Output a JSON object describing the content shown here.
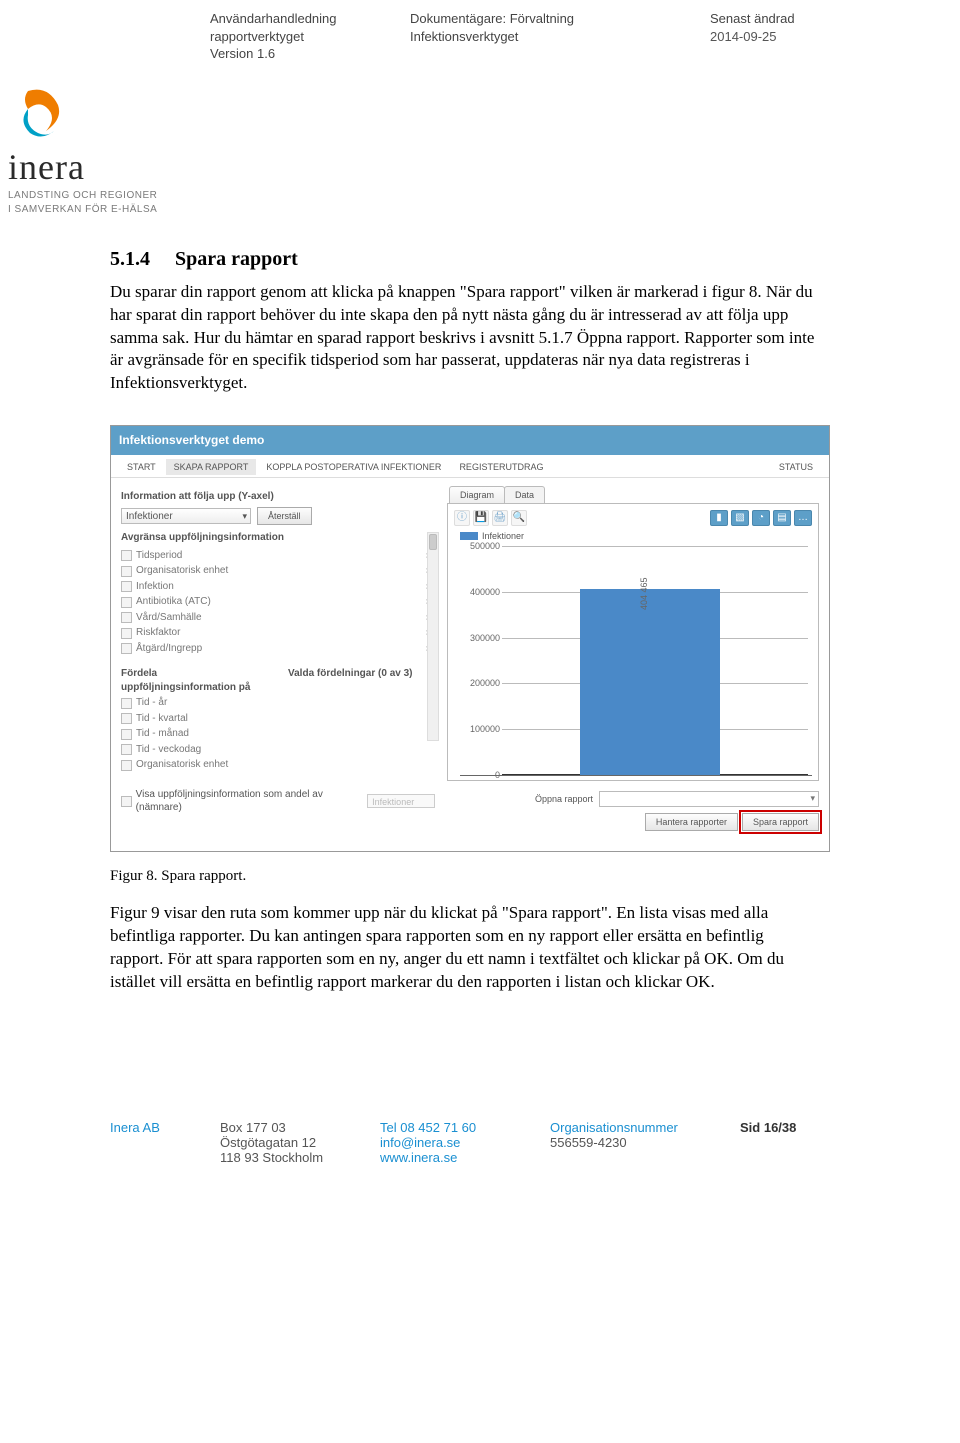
{
  "header": {
    "doc_title": "Användarhandledning rapportverktyget",
    "version": "Version 1.6",
    "owner_label": "Dokumentägare: Förvaltning",
    "owner_name": "Infektionsverktyget",
    "changed_label": "Senast ändrad",
    "changed_date": "2014-09-25",
    "logo_name": "inera",
    "logo_tag1": "LANDSTING OCH REGIONER",
    "logo_tag2": "I SAMVERKAN FÖR E-HÄLSA"
  },
  "section": {
    "num": "5.1.4",
    "title": "Spara rapport",
    "para": "Du sparar din rapport genom att klicka på knappen \"Spara rapport\" vilken är markerad i figur 8. När du har sparat din rapport behöver du inte skapa den på nytt nästa gång du är intresserad av att följa upp samma sak. Hur du hämtar en sparad rapport beskrivs i avsnitt 5.1.7 Öppna rapport. Rapporter som inte är avgränsade för en specifik tidsperiod som har passerat, uppdateras när nya data registreras i Infektionsverktyget.",
    "caption": "Figur 8. Spara rapport.",
    "para2": "Figur 9 visar den ruta som kommer upp när du klickat på \"Spara rapport\". En lista visas med alla befintliga rapporter. Du kan antingen spara rapporten som en ny rapport eller ersätta en befintlig rapport. För att spara rapporten som en ny, anger du ett namn i textfältet och klickar på OK. Om du istället vill ersätta en befintlig rapport markerar du den rapporten i listan och klickar OK."
  },
  "app": {
    "title": "Infektionsverktyget demo",
    "nav": {
      "start": "START",
      "skapa": "SKAPA RAPPORT",
      "koppla": "KOPPLA POSTOPERATIVA INFEKTIONER",
      "register": "REGISTERUTDRAG",
      "status": "STATUS"
    },
    "left": {
      "info_label": "Information att följa upp (Y-axel)",
      "select_value": "Infektioner",
      "reset_btn": "Återställ",
      "filter_label": "Avgränsa uppföljningsinformation",
      "filters": {
        "f0": "Tidsperiod",
        "f1": "Organisatorisk enhet",
        "f2": "Infektion",
        "f3": "Antibiotika (ATC)",
        "f4": "Vård/Samhälle",
        "f5": "Riskfaktor",
        "f6": "Åtgärd/Ingrepp"
      },
      "split_label": "Fördela uppföljningsinformation på",
      "split_right": "Valda fördelningar (0 av 3)",
      "splits": {
        "s0": "Tid - år",
        "s1": "Tid - kvartal",
        "s2": "Tid - månad",
        "s3": "Tid - veckodag",
        "s4": "Organisatorisk enhet"
      },
      "andel": "Visa uppföljningsinformation som andel av (nämnare)",
      "andel_value": "Infektioner"
    },
    "right": {
      "tab_diagram": "Diagram",
      "tab_data": "Data",
      "legend": "Infektioner",
      "open_label": "Öppna rapport",
      "btn_hantera": "Hantera rapporter",
      "btn_spara": "Spara rapport"
    }
  },
  "chart_data": {
    "type": "bar",
    "categories": [
      ""
    ],
    "values": [
      404465
    ],
    "ylim": [
      0,
      500000
    ],
    "yticks": {
      "t0": "0",
      "t1": "100000",
      "t2": "200000",
      "t3": "300000",
      "t4": "400000",
      "t5": "500000"
    },
    "bar_label": "404 465"
  },
  "footer": {
    "company": "Inera AB",
    "box": "Box 177 03",
    "street": "Östgötagatan 12",
    "zip": "118 93 Stockholm",
    "tel": "Tel 08 452 71 60",
    "email": "info@inera.se",
    "web": "www.inera.se",
    "org_label": "Organisationsnummer",
    "org_no": "556559-4230",
    "page": "Sid 16/38"
  }
}
